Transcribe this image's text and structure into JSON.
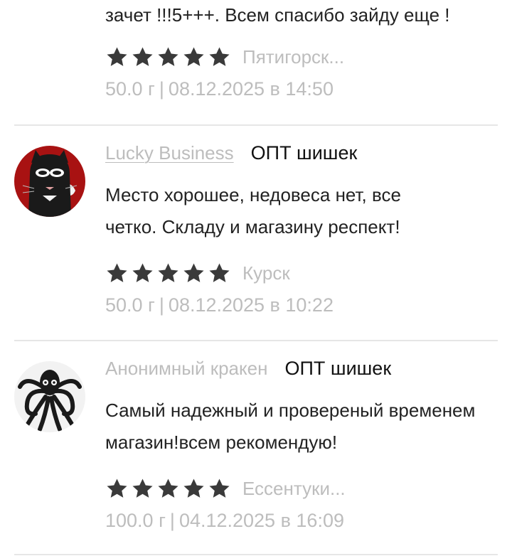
{
  "reviews": [
    {
      "author": "",
      "category": "",
      "text": "зачет !!!5+++. Всем спасибо зайду еще !",
      "rating": 5,
      "city": "Пятигорск...",
      "weight": "50.0 г",
      "separator": "|",
      "date": "08.12.2025 в 14:50"
    },
    {
      "author": "Lucky Business",
      "category": "ОПТ шишек",
      "text": "Место хорошее, недовеса нет, все четко. Складу и магазину респект!",
      "rating": 5,
      "city": "Курск",
      "weight": "50.0 г",
      "separator": "|",
      "date": "08.12.2025 в 10:22",
      "avatar_icon": "masked-cat-avatar"
    },
    {
      "author": "Анонимный кракен",
      "category": "ОПТ шишек",
      "text": "Самый надежный и провереный временем магазин!всем рекомендую!",
      "rating": 5,
      "city": "Ессентуки...",
      "weight": "100.0 г",
      "separator": "|",
      "date": "04.12.2025 в 16:09",
      "avatar_icon": "kraken-avatar"
    }
  ],
  "colors": {
    "star": "#3a3a3a",
    "muted": "#bdbdbd",
    "divider": "#e6e6e6",
    "avatar_red": "#a81212"
  }
}
